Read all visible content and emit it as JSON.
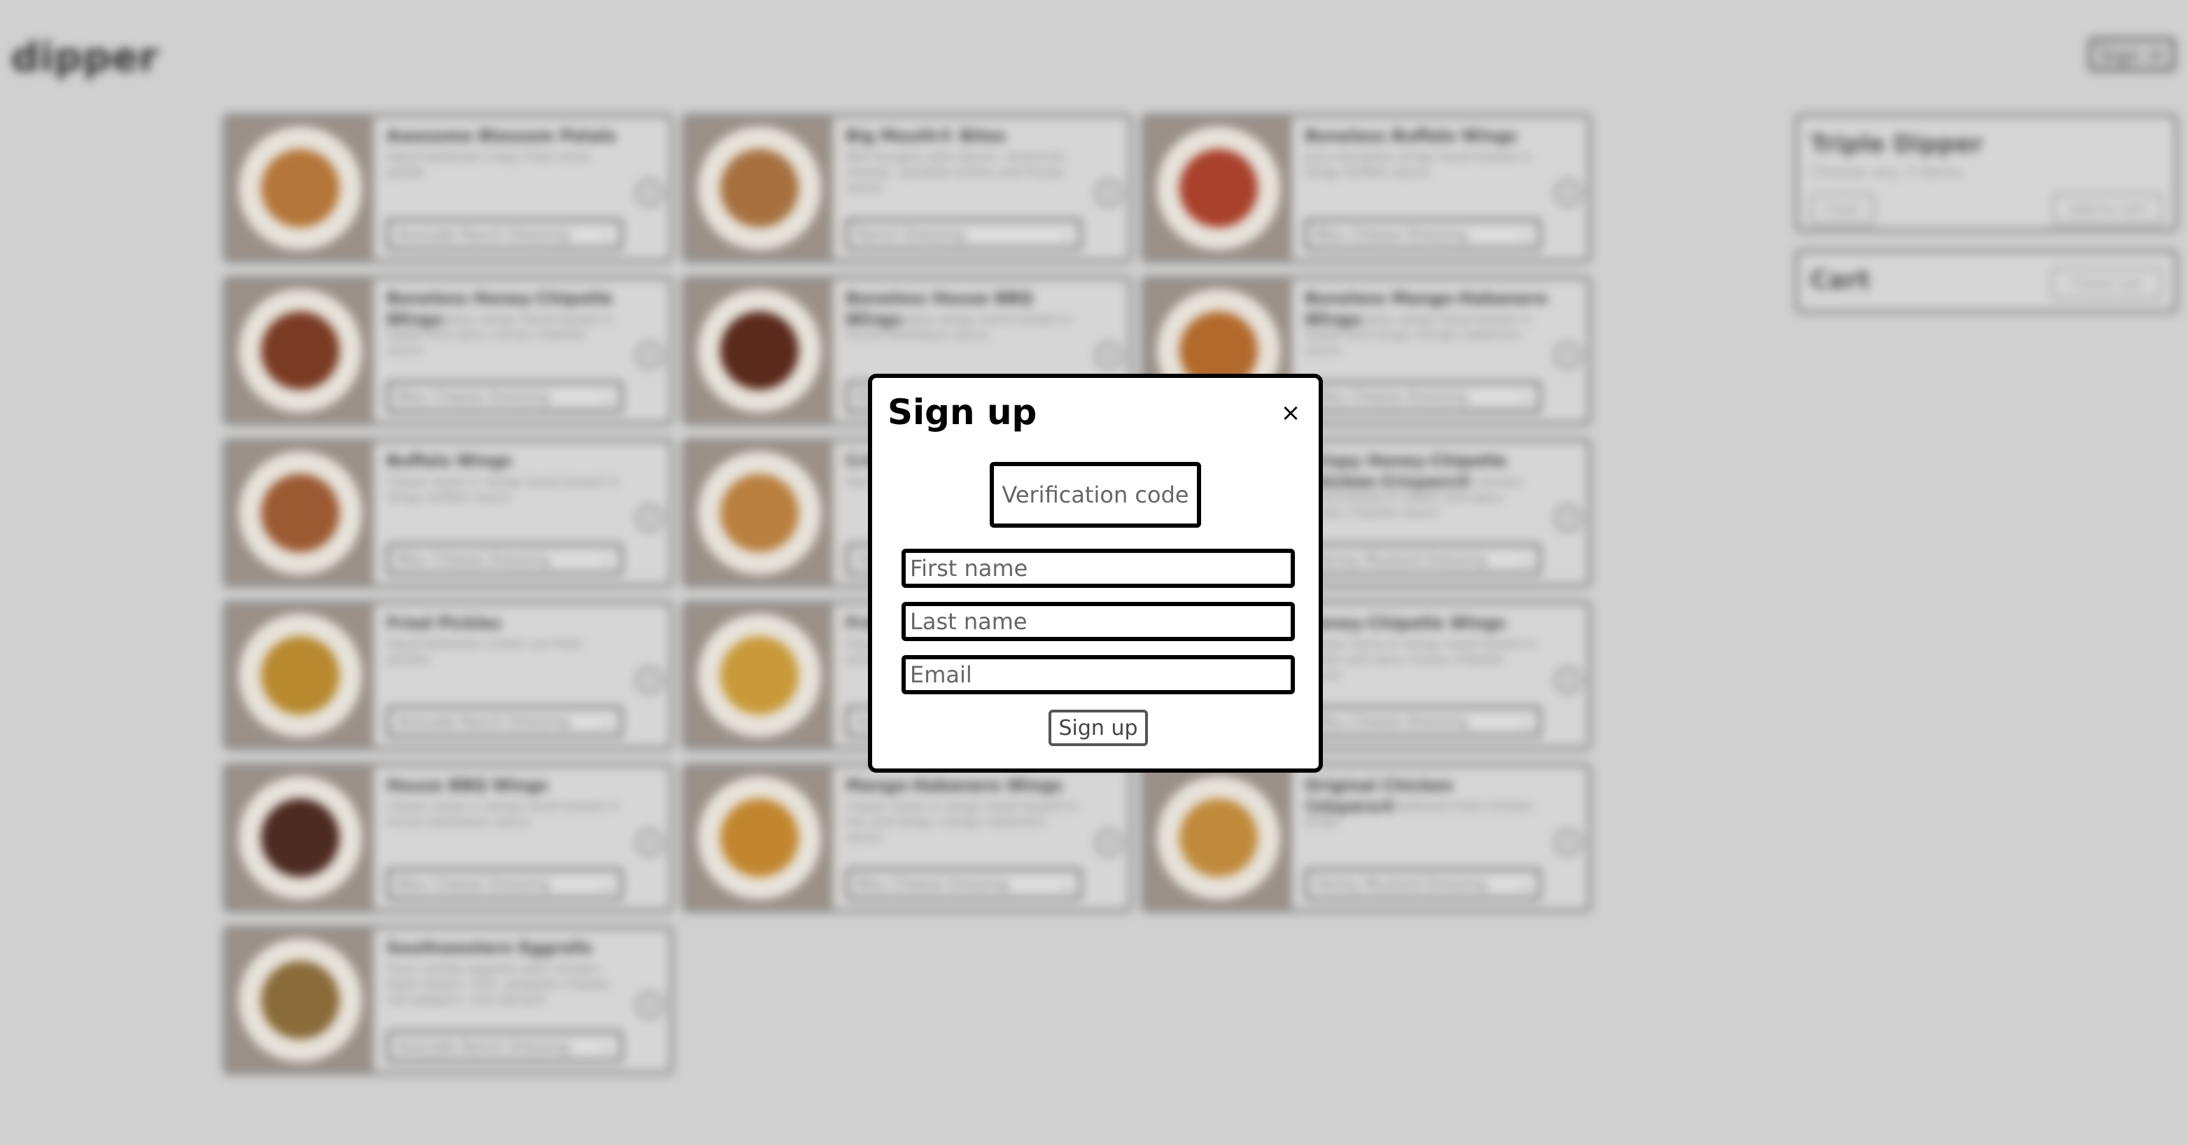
{
  "header": {
    "logo": "dipper",
    "sign_in_label": "Sign in"
  },
  "menu_items": [
    {
      "title": "Awesome Blossom Petals",
      "desc": "Hand-battered crispy fried onion petals",
      "dressing": "Avocado Ranch Dressing",
      "color": "#b5763a"
    },
    {
      "title": "Big Mouth® Bites",
      "desc": "Mini burgers with bacon, American cheese, sautéed onions and house sauce",
      "dressing": "Ranch Dressing",
      "color": "#a7713f"
    },
    {
      "title": "Boneless Buffalo Wings",
      "desc": "Juicy boneless wings hand-tossed in tangy buffalo sauce",
      "dressing": "Bleu Cheese Dressing",
      "color": "#a9412c"
    },
    {
      "title": "Boneless Honey-Chipotle Wings",
      "desc": "Juicy boneless wings hand-tossed in sweet and spicy honey chipotle sauce",
      "dressing": "Bleu Cheese Dressing",
      "color": "#7a3b24"
    },
    {
      "title": "Boneless House BBQ Wings",
      "desc": "Juicy boneless wings hand-tossed in house barbeque sauce",
      "dressing": "Bleu Cheese Dressing",
      "color": "#5a2a1c"
    },
    {
      "title": "Boneless Mango-Habanero Wings",
      "desc": "Juicy boneless wings hand-tossed in sweet and tangy mango habanero sauce",
      "dressing": "Bleu Cheese Dressing",
      "color": "#b26a2c"
    },
    {
      "title": "Buffalo Wings",
      "desc": "Classic bone-in wings hand-tossed in tangy buffalo sauce",
      "dressing": "Bleu Cheese Dressing",
      "color": "#9c5a33"
    },
    {
      "title": "Crispy Chicken Crispers",
      "desc": "Hand-battered crispy fried chicken",
      "dressing": "Honey Mustard Dressing",
      "color": "#b98040"
    },
    {
      "title": "Crispy Honey-Chipotle Chicken Crispers®",
      "desc": "Hand-battered crispy fried chicken hand-tossed in sweet and spicy honey chipotle sauce",
      "dressing": "Honey Mustard Dressing",
      "color": "#6d3421"
    },
    {
      "title": "Fried Pickles",
      "desc": "Hand-battered crinkle cut fried pickles",
      "dressing": "Avocado Ranch Dressing",
      "color": "#b8892f"
    },
    {
      "title": "Fried Pickles",
      "desc": "Hand-battered crinkle cut fried pickles",
      "dressing": "Avocado Ranch Dressing",
      "color": "#c99a3a"
    },
    {
      "title": "Honey-Chipotle Wings",
      "desc": "Classic bone-in wings hand-tossed in sweet and spicy honey chipotle sauce",
      "dressing": "Bleu Cheese Dressing",
      "color": "#93502c"
    },
    {
      "title": "House BBQ Wings",
      "desc": "Classic bone-in wings hand-tossed in house barbeque sauce",
      "dressing": "Bleu Cheese Dressing",
      "color": "#4d2a22"
    },
    {
      "title": "Mango-Habanero Wings",
      "desc": "Classic bone-in wings hand-tossed in hot and tangy mango habanero sauce",
      "dressing": "Bleu Cheese Dressing",
      "color": "#c2862f"
    },
    {
      "title": "Original Chicken Crispers®",
      "desc": "Original hand-battered fried chicken strips",
      "dressing": "Honey Mustard Dressing",
      "color": "#c08a3c"
    },
    {
      "title": "Southwestern Eggrolls",
      "desc": "Flour tortilla eggrolls with chicken, black beans, corn, jalapeño cheese, red peppers, and spinach",
      "dressing": "Avocado Ranch Dressing",
      "color": "#8a6b3a"
    }
  ],
  "triple": {
    "title": "Triple Dipper",
    "subtitle": "Choose any 3 items",
    "clear_label": "Clear",
    "add_label": "Add to cart"
  },
  "cart": {
    "title": "Cart",
    "checkout_label": "Check out"
  },
  "modal": {
    "title": "Sign up",
    "close_glyph": "×",
    "code_placeholder": "Verification code",
    "first_placeholder": "First name",
    "last_placeholder": "Last name",
    "email_placeholder": "Email",
    "submit_label": "Sign up"
  }
}
